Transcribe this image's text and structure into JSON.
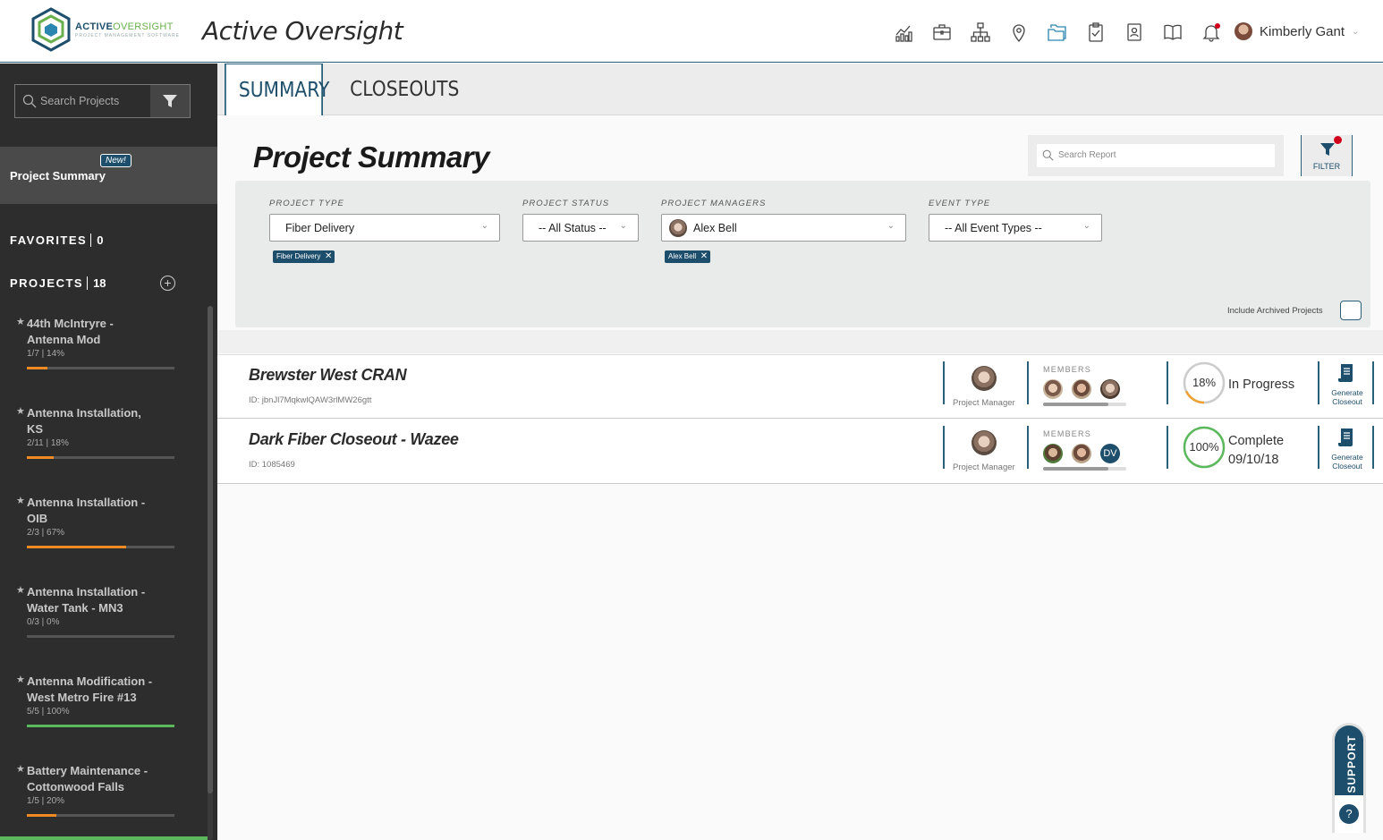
{
  "header": {
    "logo_text_a": "ACTIVE",
    "logo_text_b": "OVERSIGHT",
    "logo_sub": "PROJECT MANAGEMENT SOFTWARE",
    "app_title": "Active Oversight",
    "nav_icons": [
      "analytics-icon",
      "briefcase-icon",
      "org-chart-icon",
      "map-pin-icon",
      "folders-icon",
      "clipboard-check-icon",
      "contacts-icon",
      "book-icon",
      "bell-icon"
    ],
    "user_name": "Kimberly Gant"
  },
  "sidebar": {
    "search_placeholder": "Search Projects",
    "project_summary_label": "Project Summary",
    "new_badge": "New!",
    "favorites_label": "FAVORITES",
    "favorites_count": "0",
    "projects_label": "PROJECTS",
    "projects_count": "18",
    "projects": [
      {
        "line1": "44th McIntryre -",
        "line2": "Antenna Mod",
        "meta": "1/7 | 14%",
        "progress": 0.14
      },
      {
        "line1": "Antenna Installation,",
        "line2": "KS",
        "meta": "2/11 | 18%",
        "progress": 0.18
      },
      {
        "line1": "Antenna Installation -",
        "line2": "OIB",
        "meta": "2/3 | 67%",
        "progress": 0.67
      },
      {
        "line1": "Antenna Installation -",
        "line2": "Water Tank - MN3",
        "meta": "0/3 | 0%",
        "progress": 0.0
      },
      {
        "line1": "Antenna Modification -",
        "line2": "West Metro Fire #13",
        "meta": "5/5 | 100%",
        "progress": 1.0
      },
      {
        "line1": "Battery Maintenance -",
        "line2": "Cottonwood Falls",
        "meta": "1/5 | 20%",
        "progress": 0.2
      }
    ]
  },
  "tabs": {
    "summary": "SUMMARY",
    "closeouts": "CLOSEOUTS"
  },
  "main": {
    "page_title": "Project Summary",
    "report_search_placeholder": "Search Report",
    "filter_label": "FILTER",
    "filters": {
      "project_type_label": "PROJECT TYPE",
      "project_type_value": "Fiber Delivery",
      "project_type_chip": "Fiber Delivery",
      "project_status_label": "PROJECT STATUS",
      "project_status_value": "-- All Status --",
      "project_managers_label": "PROJECT MANAGERS",
      "project_managers_value": "Alex Bell",
      "project_managers_chip": "Alex Bell",
      "event_type_label": "EVENT TYPE",
      "event_type_value": "-- All Event Types --",
      "include_archived_label": "Include Archived Projects"
    },
    "rows": [
      {
        "title": "Brewster West CRAN",
        "id": "ID: jbnJl7MqkwlQAW3rlMW26gtt",
        "pm_label": "Project Manager",
        "members_label": "MEMBERS",
        "progress": "18%",
        "status_line1": "In Progress",
        "status_line2": "",
        "generate_line1": "Generate",
        "generate_line2": "Closeout"
      },
      {
        "title": "Dark Fiber Closeout - Wazee",
        "id": "ID: 1085469",
        "pm_label": "Project Manager",
        "members_label": "MEMBERS",
        "member_initials": "DV",
        "progress": "100%",
        "status_line1": "Complete",
        "status_line2": "09/10/18",
        "generate_line1": "Generate",
        "generate_line2": "Closeout"
      }
    ]
  },
  "support_label": "SUPPORT",
  "colors": {
    "brand": "#1d4e6b",
    "accent_green": "#5cb85c",
    "accent_orange": "#f08a24",
    "alert_red": "#d0021b"
  }
}
